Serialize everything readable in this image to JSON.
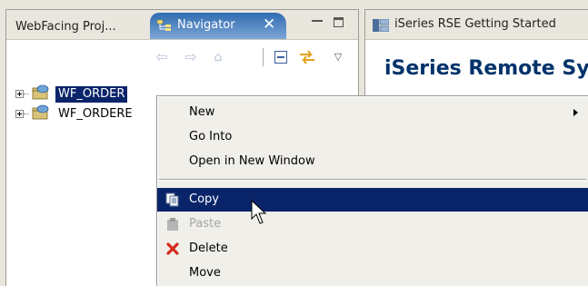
{
  "navigator_view": {
    "inactive_tab_label": "WebFacing Proj...",
    "active_tab_label": "Navigator",
    "close_glyph": "✕",
    "toolbar_icons": [
      "back-arrow-icon",
      "forward-arrow-icon",
      "go-up-icon",
      "collapse-all-icon",
      "link-with-editor-icon",
      "view-menu-icon"
    ],
    "tree_items": [
      {
        "label": "WF_ORDER",
        "selected": true
      },
      {
        "label": "WF_ORDERE",
        "selected": false
      }
    ]
  },
  "editor_view": {
    "tab_label": "iSeries RSE Getting Started",
    "heading": "iSeries Remote Sy"
  },
  "context_menu": {
    "items": [
      {
        "label": "New",
        "has_submenu": true,
        "enabled": true
      },
      {
        "label": "Go Into",
        "enabled": true
      },
      {
        "label": "Open in New Window",
        "enabled": true
      },
      {
        "label": "Copy",
        "enabled": true,
        "highlighted": true,
        "icon": "copy-icon"
      },
      {
        "label": "Paste",
        "enabled": false,
        "icon": "paste-icon"
      },
      {
        "label": "Delete",
        "enabled": true,
        "icon": "delete-icon"
      },
      {
        "label": "Move",
        "enabled": true
      }
    ]
  },
  "colors": {
    "selection": "#0a246a",
    "active_tab_top": "#2f6cb0",
    "heading": "#00336b",
    "delete_red": "#d42a1e"
  }
}
